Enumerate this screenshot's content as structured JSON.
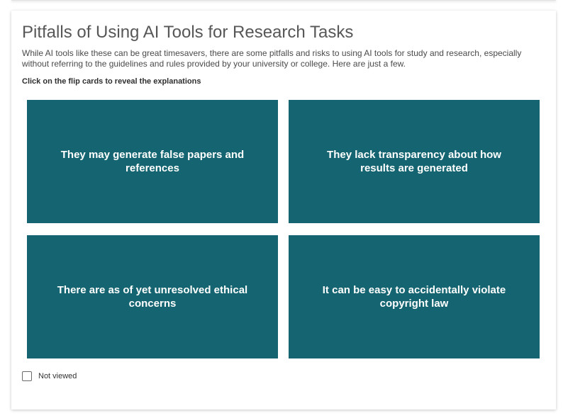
{
  "page": {
    "title": "Pitfalls of Using AI Tools for Research Tasks",
    "intro": "While AI tools like these can be great timesavers, there are some pitfalls and risks to using AI tools for study and research, especially without referring to the guidelines and rules provided by your university or college. Here are just a few.",
    "instruction": "Click on the flip cards to reveal the explanations"
  },
  "cards": [
    {
      "front": "They may generate false papers and references"
    },
    {
      "front": "They lack transparency about how results are generated"
    },
    {
      "front": "There are as of yet unresolved ethical concerns"
    },
    {
      "front": "It can be easy to accidentally violate copyright law"
    }
  ],
  "completion": {
    "label": "Not viewed",
    "checked": false
  },
  "colors": {
    "card_background": "#146571",
    "card_text": "#ffffff",
    "title_text": "#575757"
  }
}
